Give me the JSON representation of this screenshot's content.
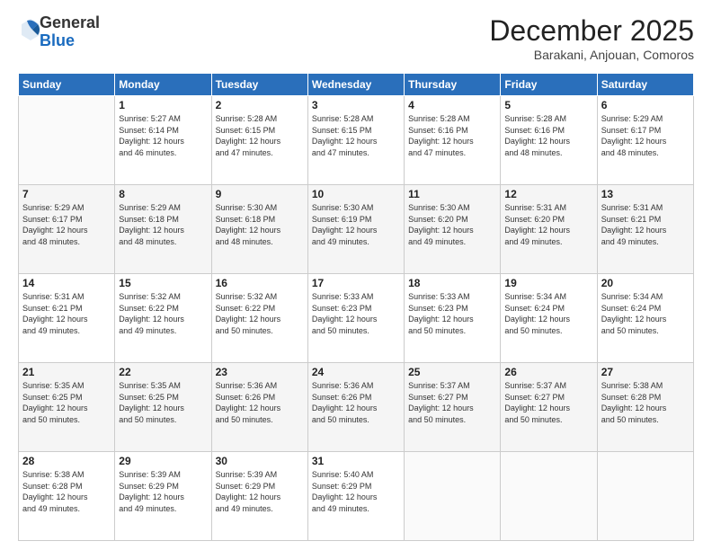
{
  "logo": {
    "general": "General",
    "blue": "Blue"
  },
  "header": {
    "month": "December 2025",
    "location": "Barakani, Anjouan, Comoros"
  },
  "weekdays": [
    "Sunday",
    "Monday",
    "Tuesday",
    "Wednesday",
    "Thursday",
    "Friday",
    "Saturday"
  ],
  "weeks": [
    [
      {
        "day": "",
        "info": ""
      },
      {
        "day": "1",
        "info": "Sunrise: 5:27 AM\nSunset: 6:14 PM\nDaylight: 12 hours\nand 46 minutes."
      },
      {
        "day": "2",
        "info": "Sunrise: 5:28 AM\nSunset: 6:15 PM\nDaylight: 12 hours\nand 47 minutes."
      },
      {
        "day": "3",
        "info": "Sunrise: 5:28 AM\nSunset: 6:15 PM\nDaylight: 12 hours\nand 47 minutes."
      },
      {
        "day": "4",
        "info": "Sunrise: 5:28 AM\nSunset: 6:16 PM\nDaylight: 12 hours\nand 47 minutes."
      },
      {
        "day": "5",
        "info": "Sunrise: 5:28 AM\nSunset: 6:16 PM\nDaylight: 12 hours\nand 48 minutes."
      },
      {
        "day": "6",
        "info": "Sunrise: 5:29 AM\nSunset: 6:17 PM\nDaylight: 12 hours\nand 48 minutes."
      }
    ],
    [
      {
        "day": "7",
        "info": "Sunrise: 5:29 AM\nSunset: 6:17 PM\nDaylight: 12 hours\nand 48 minutes."
      },
      {
        "day": "8",
        "info": "Sunrise: 5:29 AM\nSunset: 6:18 PM\nDaylight: 12 hours\nand 48 minutes."
      },
      {
        "day": "9",
        "info": "Sunrise: 5:30 AM\nSunset: 6:18 PM\nDaylight: 12 hours\nand 48 minutes."
      },
      {
        "day": "10",
        "info": "Sunrise: 5:30 AM\nSunset: 6:19 PM\nDaylight: 12 hours\nand 49 minutes."
      },
      {
        "day": "11",
        "info": "Sunrise: 5:30 AM\nSunset: 6:20 PM\nDaylight: 12 hours\nand 49 minutes."
      },
      {
        "day": "12",
        "info": "Sunrise: 5:31 AM\nSunset: 6:20 PM\nDaylight: 12 hours\nand 49 minutes."
      },
      {
        "day": "13",
        "info": "Sunrise: 5:31 AM\nSunset: 6:21 PM\nDaylight: 12 hours\nand 49 minutes."
      }
    ],
    [
      {
        "day": "14",
        "info": "Sunrise: 5:31 AM\nSunset: 6:21 PM\nDaylight: 12 hours\nand 49 minutes."
      },
      {
        "day": "15",
        "info": "Sunrise: 5:32 AM\nSunset: 6:22 PM\nDaylight: 12 hours\nand 49 minutes."
      },
      {
        "day": "16",
        "info": "Sunrise: 5:32 AM\nSunset: 6:22 PM\nDaylight: 12 hours\nand 50 minutes."
      },
      {
        "day": "17",
        "info": "Sunrise: 5:33 AM\nSunset: 6:23 PM\nDaylight: 12 hours\nand 50 minutes."
      },
      {
        "day": "18",
        "info": "Sunrise: 5:33 AM\nSunset: 6:23 PM\nDaylight: 12 hours\nand 50 minutes."
      },
      {
        "day": "19",
        "info": "Sunrise: 5:34 AM\nSunset: 6:24 PM\nDaylight: 12 hours\nand 50 minutes."
      },
      {
        "day": "20",
        "info": "Sunrise: 5:34 AM\nSunset: 6:24 PM\nDaylight: 12 hours\nand 50 minutes."
      }
    ],
    [
      {
        "day": "21",
        "info": "Sunrise: 5:35 AM\nSunset: 6:25 PM\nDaylight: 12 hours\nand 50 minutes."
      },
      {
        "day": "22",
        "info": "Sunrise: 5:35 AM\nSunset: 6:25 PM\nDaylight: 12 hours\nand 50 minutes."
      },
      {
        "day": "23",
        "info": "Sunrise: 5:36 AM\nSunset: 6:26 PM\nDaylight: 12 hours\nand 50 minutes."
      },
      {
        "day": "24",
        "info": "Sunrise: 5:36 AM\nSunset: 6:26 PM\nDaylight: 12 hours\nand 50 minutes."
      },
      {
        "day": "25",
        "info": "Sunrise: 5:37 AM\nSunset: 6:27 PM\nDaylight: 12 hours\nand 50 minutes."
      },
      {
        "day": "26",
        "info": "Sunrise: 5:37 AM\nSunset: 6:27 PM\nDaylight: 12 hours\nand 50 minutes."
      },
      {
        "day": "27",
        "info": "Sunrise: 5:38 AM\nSunset: 6:28 PM\nDaylight: 12 hours\nand 50 minutes."
      }
    ],
    [
      {
        "day": "28",
        "info": "Sunrise: 5:38 AM\nSunset: 6:28 PM\nDaylight: 12 hours\nand 49 minutes."
      },
      {
        "day": "29",
        "info": "Sunrise: 5:39 AM\nSunset: 6:29 PM\nDaylight: 12 hours\nand 49 minutes."
      },
      {
        "day": "30",
        "info": "Sunrise: 5:39 AM\nSunset: 6:29 PM\nDaylight: 12 hours\nand 49 minutes."
      },
      {
        "day": "31",
        "info": "Sunrise: 5:40 AM\nSunset: 6:29 PM\nDaylight: 12 hours\nand 49 minutes."
      },
      {
        "day": "",
        "info": ""
      },
      {
        "day": "",
        "info": ""
      },
      {
        "day": "",
        "info": ""
      }
    ]
  ]
}
